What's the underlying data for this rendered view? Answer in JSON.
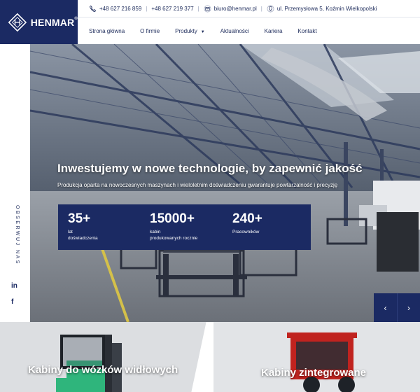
{
  "brand": {
    "name": "HENMAR",
    "mark": "®"
  },
  "topbar": {
    "phone1": "+48 627 216 859",
    "phone2": "+48 627 219 377",
    "email": "biuro@henmar.pl",
    "address": "ul. Przemysłowa 5, Koźmin Wielkopolski"
  },
  "nav": {
    "items": [
      "Strona główna",
      "O firmie",
      "Produkty",
      "Aktualności",
      "Kariera",
      "Kontakt"
    ]
  },
  "rail": {
    "follow": "OBSERWUJ NAS",
    "linkedin": "in",
    "facebook": "f"
  },
  "hero": {
    "title": "Inwestujemy w nowe technologie, by zapewnić jakość",
    "subtitle": "Produkcja oparta na nowoczesnych maszynach i wieloletnim doświadczeniu gwarantuje powtarzalność i precyzję",
    "stats": [
      {
        "value": "35+",
        "label_line1": "lat",
        "label_line2": "doświadczenia"
      },
      {
        "value": "15000+",
        "label_line1": "kabin",
        "label_line2": "produkowanych rocznie"
      },
      {
        "value": "240+",
        "label_line1": "Pracowników",
        "label_line2": ""
      }
    ],
    "prev": "‹",
    "next": "›"
  },
  "cards": [
    {
      "label": "Kabiny do wózków widłowych"
    },
    {
      "label": "Kabiny zintegrowane"
    }
  ],
  "colors": {
    "navy": "#1b2a63",
    "accent_green": "#2fb57c",
    "accent_red": "#c0231f"
  }
}
